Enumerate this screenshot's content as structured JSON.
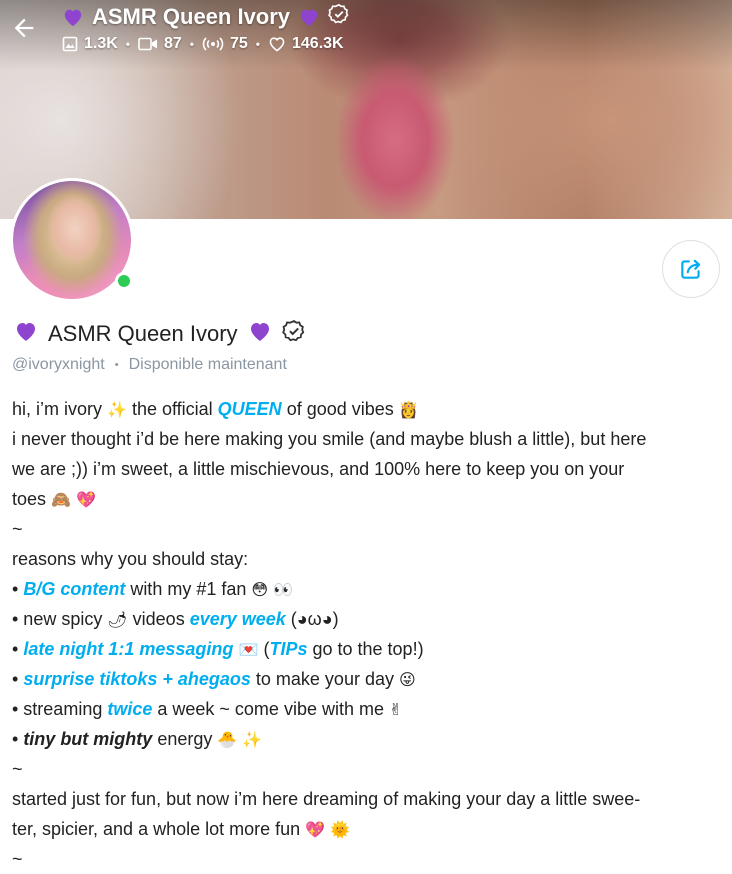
{
  "header": {
    "back_icon": "arrow-left-icon",
    "title": "ASMR Queen Ivory",
    "title_emoji": "💜",
    "stats": {
      "photos": "1.3K",
      "videos": "87",
      "streams": "75",
      "likes": "146.3K"
    }
  },
  "profile": {
    "name": "ASMR Queen Ivory",
    "name_emoji": "💜",
    "handle": "@ivoryxnight",
    "separator": "•",
    "status": "Disponible maintenant",
    "online_color": "#2ecc55",
    "accent_color": "#00aeef"
  },
  "bio": {
    "l1a": "hi, i’m ivory ",
    "l1e1": "✨",
    "l1b": " the official ",
    "l1hl": "QUEEN",
    "l1c": " of good vibes ",
    "l1e2": "👸",
    "l2": "i never thought i’d be here making you smile (and maybe blush a little), but here",
    "l3": "we are ;)) i’m sweet, a little mischievous, and 100% here to keep you on your",
    "l4a": "toes ",
    "l4e": "🙈 💖",
    "l5": "~",
    "l6": "reasons why you should stay:",
    "l7a": "• ",
    "l7hl": "B/G content",
    "l7b": " with my #1 fan ",
    "l7e": "😳 👀",
    "l8a": "• new spicy ",
    "l8e1": "🌶",
    "l8b": " videos ",
    "l8hl": "every week",
    "l8c": " (◕ω◕)",
    "l9a": "• ",
    "l9hl": "late night 1:1 messaging",
    "l9e": " 💌 ",
    "l9b": " (",
    "l9hl2": "TIPs",
    "l9c": " go to the top!)",
    "l10a": "• ",
    "l10hl": "surprise tiktoks + ahegaos",
    "l10b": " to make your day ",
    "l10e": "😜",
    "l11a": "• streaming ",
    "l11hl": "twice",
    "l11b": " a week ~ come vibe with me ",
    "l11e": "✌",
    "l12a": "• ",
    "l12bi": "tiny but mighty",
    "l12b": " energy ",
    "l12e": "🐣 ✨",
    "l13": "~",
    "l14": "started just for fun, but now i’m here dreaming of making your day a little swee-",
    "l15a": "ter, spicier, and a whole lot more fun ",
    "l15e": "💖 🌞",
    "l16": "~"
  }
}
